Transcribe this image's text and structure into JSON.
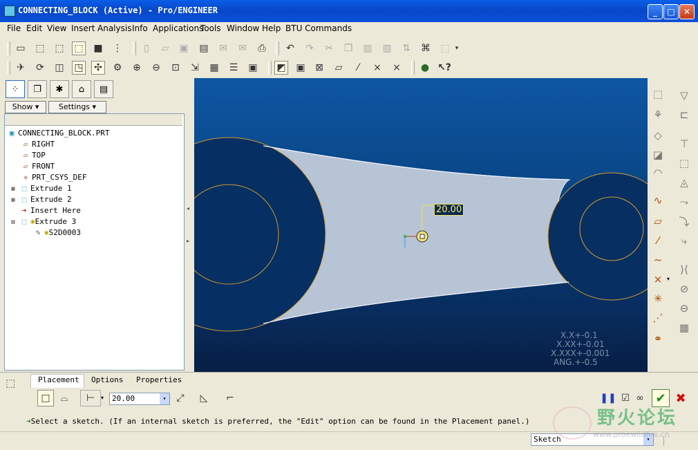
{
  "window": {
    "title": "CONNECTING_BLOCK (Active) - Pro/ENGINEER"
  },
  "menu": [
    "File",
    "Edit",
    "View",
    "Insert",
    "Analysis",
    "Info",
    "Applications",
    "Tools",
    "Window",
    "Help",
    "BTU Commands"
  ],
  "left_panel": {
    "show_label": "Show",
    "settings_label": "Settings",
    "tree": [
      {
        "label": "CONNECTING_BLOCK.PRT",
        "icon": "part-icon"
      },
      {
        "label": "RIGHT",
        "icon": "datum-plane-icon"
      },
      {
        "label": "TOP",
        "icon": "datum-plane-icon"
      },
      {
        "label": "FRONT",
        "icon": "datum-plane-icon"
      },
      {
        "label": "PRT_CSYS_DEF",
        "icon": "csys-icon"
      },
      {
        "label": "Extrude 1",
        "icon": "extrude-icon"
      },
      {
        "label": "Extrude 2",
        "icon": "extrude-icon"
      },
      {
        "label": "Insert Here",
        "icon": "insert-arrow-icon"
      },
      {
        "label": "Extrude 3",
        "icon": "extrude-icon"
      },
      {
        "label": "S2D0003",
        "icon": "sketch-icon"
      }
    ]
  },
  "graphics": {
    "dimension_value": "20.00",
    "tolerances": [
      "X.X+-0.1",
      "X.XX+-0.01",
      "X.XXX+-0.001",
      "ANG.+-0.5"
    ]
  },
  "dashboard": {
    "tabs": [
      "Placement",
      "Options",
      "Properties"
    ],
    "depth_value": "20.00",
    "message": "Select a sketch. (If an internal sketch is preferred, the \"Edit\" option can be found in the Placement panel.)"
  },
  "status": {
    "filter_value": "Sketch",
    "watermark_text": "野火论坛",
    "watermark_url": "www.proewildfire.cn"
  },
  "colors": {
    "accent": "#0a4fd8",
    "curve": "#d79b2d",
    "model_fill": "#b9c6d6"
  }
}
